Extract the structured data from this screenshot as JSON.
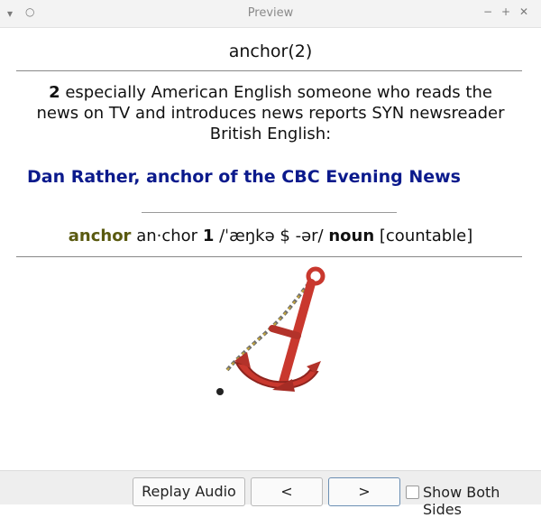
{
  "window": {
    "title": "Preview",
    "menu_icon": "chevron-down-icon",
    "pin_icon": "circle-icon",
    "minimize_icon": "minimize-icon",
    "maximize_icon": "plus-icon",
    "close_icon": "close-icon"
  },
  "card": {
    "heading": "anchor(2)",
    "definition": {
      "number": "2",
      "text": " especially American English someone who reads the news on TV and introduces news reports SYN newsreader British English:"
    },
    "example": "Dan Rather, anchor of the CBC Evening News",
    "headword": {
      "word": "anchor",
      "syllables": "an·chor",
      "sense_number": "1",
      "pronunciation": "/ˈæŋkə $ -ər/",
      "part_of_speech": "noun",
      "grammar": "[countable]"
    },
    "image_icon": "anchor-image"
  },
  "bottom_bar": {
    "replay_label": "Replay Audio",
    "prev_label": "<",
    "next_label": ">",
    "show_both_label": "Show Both Sides",
    "show_both_checked": false
  },
  "colors": {
    "example": "#0b1a8c",
    "headword": "#5a5a10"
  }
}
